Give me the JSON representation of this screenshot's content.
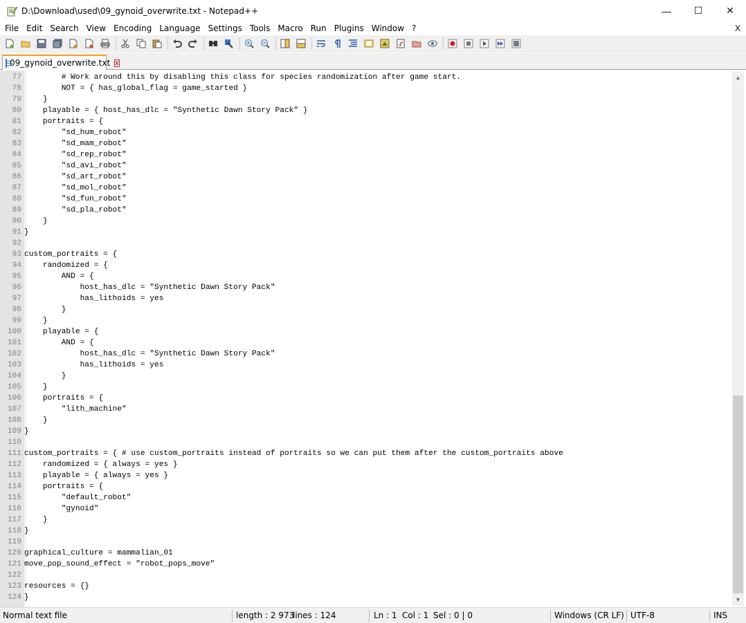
{
  "window": {
    "title": "D:\\Download\\used\\09_gynoid_overwrite.txt - Notepad++",
    "minimize": "—",
    "maximize": "☐",
    "close": "✕"
  },
  "menu": {
    "items": [
      "File",
      "Edit",
      "Search",
      "View",
      "Encoding",
      "Language",
      "Settings",
      "Tools",
      "Macro",
      "Run",
      "Plugins",
      "Window",
      "?"
    ],
    "close": "X"
  },
  "toolbar": {
    "icons": [
      "new-file-icon",
      "open-file-icon",
      "save-icon",
      "save-all-icon",
      "close-icon",
      "close-all-icon",
      "print-icon",
      "cut-icon",
      "copy-icon",
      "paste-icon",
      "undo-icon",
      "redo-icon",
      "find-icon",
      "replace-icon",
      "zoom-in-icon",
      "zoom-out-icon",
      "sync-vertical-icon",
      "sync-horizontal-icon",
      "word-wrap-icon",
      "show-all-chars-icon",
      "indent-guide-icon",
      "user-defined-language-icon",
      "document-map-icon",
      "function-list-icon",
      "folder-workspace-icon",
      "monitoring-icon",
      "record-macro-icon",
      "stop-macro-icon",
      "play-macro-icon",
      "run-macro-multiple-icon",
      "save-macro-icon"
    ]
  },
  "tab": {
    "label": "09_gynoid_overwrite.txt",
    "close": "x"
  },
  "editor": {
    "lines": [
      {
        "n": "77",
        "t": "        # Work around this by disabling this class for species randomization after game start."
      },
      {
        "n": "78",
        "t": "        NOT = { has_global_flag = game_started }"
      },
      {
        "n": "79",
        "t": "    }"
      },
      {
        "n": "80",
        "t": "    playable = { host_has_dlc = \"Synthetic Dawn Story Pack\" }"
      },
      {
        "n": "81",
        "t": "    portraits = {"
      },
      {
        "n": "82",
        "t": "        \"sd_hum_robot\""
      },
      {
        "n": "83",
        "t": "        \"sd_mam_robot\""
      },
      {
        "n": "84",
        "t": "        \"sd_rep_robot\""
      },
      {
        "n": "85",
        "t": "        \"sd_avi_robot\""
      },
      {
        "n": "86",
        "t": "        \"sd_art_robot\""
      },
      {
        "n": "87",
        "t": "        \"sd_mol_robot\""
      },
      {
        "n": "88",
        "t": "        \"sd_fun_robot\""
      },
      {
        "n": "89",
        "t": "        \"sd_pla_robot\""
      },
      {
        "n": "90",
        "t": "    }"
      },
      {
        "n": "91",
        "t": "}"
      },
      {
        "n": "92",
        "t": ""
      },
      {
        "n": "93",
        "t": "custom_portraits = {"
      },
      {
        "n": "94",
        "t": "    randomized = {"
      },
      {
        "n": "95",
        "t": "        AND = {"
      },
      {
        "n": "96",
        "t": "            host_has_dlc = \"Synthetic Dawn Story Pack\""
      },
      {
        "n": "97",
        "t": "            has_lithoids = yes"
      },
      {
        "n": "98",
        "t": "        }"
      },
      {
        "n": "99",
        "t": "    }"
      },
      {
        "n": "100",
        "t": "    playable = {"
      },
      {
        "n": "101",
        "t": "        AND = {"
      },
      {
        "n": "102",
        "t": "            host_has_dlc = \"Synthetic Dawn Story Pack\""
      },
      {
        "n": "103",
        "t": "            has_lithoids = yes"
      },
      {
        "n": "104",
        "t": "        }"
      },
      {
        "n": "105",
        "t": "    }"
      },
      {
        "n": "106",
        "t": "    portraits = {"
      },
      {
        "n": "107",
        "t": "        \"lith_machine\""
      },
      {
        "n": "108",
        "t": "    }"
      },
      {
        "n": "109",
        "t": "}"
      },
      {
        "n": "110",
        "t": ""
      },
      {
        "n": "111",
        "t": "custom_portraits = { # use custom_portraits instead of portraits so we can put them after the custom_portraits above"
      },
      {
        "n": "112",
        "t": "    randomized = { always = yes }"
      },
      {
        "n": "113",
        "t": "    playable = { always = yes }"
      },
      {
        "n": "114",
        "t": "    portraits = {"
      },
      {
        "n": "115",
        "t": "        \"default_robot\""
      },
      {
        "n": "116",
        "t": "        \"gynoid\""
      },
      {
        "n": "117",
        "t": "    }"
      },
      {
        "n": "118",
        "t": "}"
      },
      {
        "n": "119",
        "t": ""
      },
      {
        "n": "120",
        "t": "graphical_culture = mammalian_01"
      },
      {
        "n": "121",
        "t": "move_pop_sound_effect = \"robot_pops_move\""
      },
      {
        "n": "122",
        "t": ""
      },
      {
        "n": "123",
        "t": "resources = {}"
      },
      {
        "n": "124",
        "t": "}"
      }
    ]
  },
  "status": {
    "file_type": "Normal text file",
    "length": "length : 2 973",
    "lines": "lines : 124",
    "ln": "Ln : 1",
    "col": "Col : 1",
    "sel": "Sel : 0 | 0",
    "eol": "Windows (CR LF)",
    "encoding": "UTF-8",
    "mode": "INS"
  },
  "colors": {
    "tab_accent": "#f6a01a",
    "gutter": "#e4e4e4",
    "line_number": "#808080"
  }
}
